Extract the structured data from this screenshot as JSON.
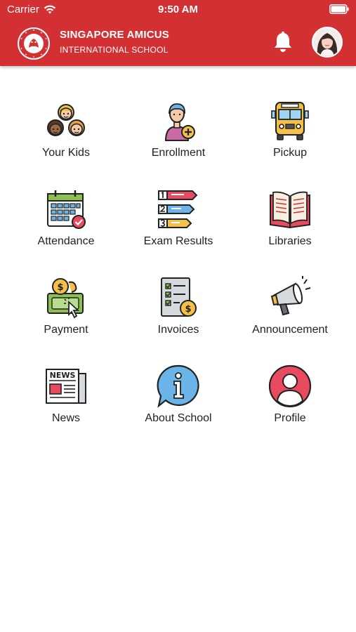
{
  "status_bar": {
    "carrier": "Carrier",
    "time": "9:50 AM"
  },
  "header": {
    "title_line1": "SINGAPORE AMICUS",
    "title_line2": "INTERNATIONAL SCHOOL",
    "logo_text": "SINGAPORE AMICUS · INTERNATIONAL SCHOOL",
    "notification_icon": "bell-icon",
    "avatar_icon": "user-avatar"
  },
  "colors": {
    "brand": "#d23033",
    "text": "#222222",
    "background": "#ffffff"
  },
  "menu": [
    {
      "label": "Your Kids",
      "icon": "kids-icon"
    },
    {
      "label": "Enrollment",
      "icon": "enrollment-icon"
    },
    {
      "label": "Pickup",
      "icon": "school-bus-icon"
    },
    {
      "label": "Attendance",
      "icon": "calendar-icon"
    },
    {
      "label": "Exam Results",
      "icon": "ranking-icon"
    },
    {
      "label": "Libraries",
      "icon": "book-icon"
    },
    {
      "label": "Payment",
      "icon": "payment-icon"
    },
    {
      "label": "Invoices",
      "icon": "invoice-icon"
    },
    {
      "label": "Announcement",
      "icon": "megaphone-icon"
    },
    {
      "label": "News",
      "icon": "newspaper-icon"
    },
    {
      "label": "About School",
      "icon": "info-icon"
    },
    {
      "label": "Profile",
      "icon": "profile-icon"
    }
  ]
}
